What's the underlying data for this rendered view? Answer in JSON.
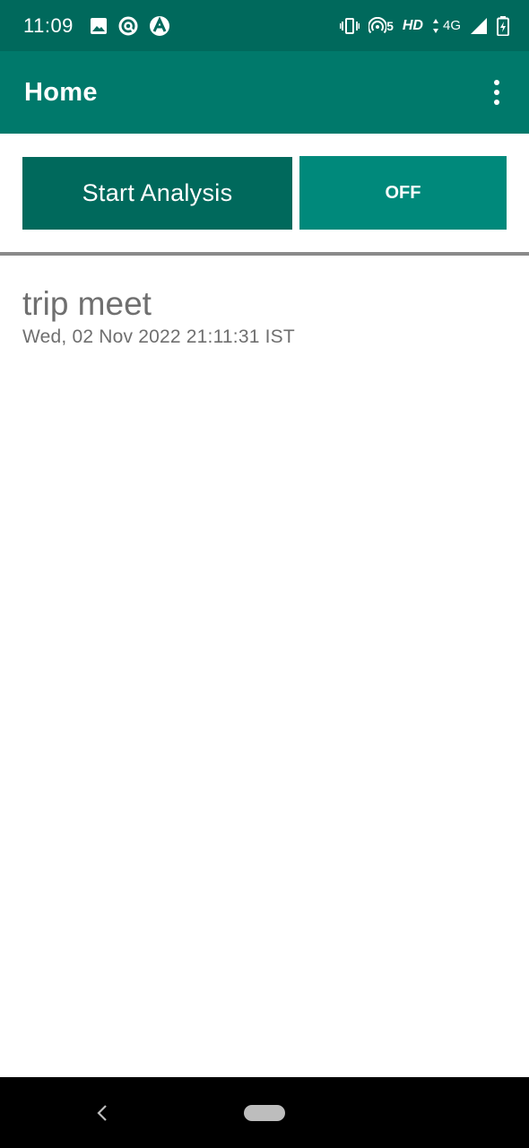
{
  "status_bar": {
    "time": "11:09",
    "left_icons": [
      "image-icon",
      "data-saver-icon",
      "vpn-a-icon"
    ],
    "right_icons": [
      "vibrate-icon",
      "hotspot-icon",
      "data-arrows-icon",
      "signal-icon",
      "battery-charging-icon"
    ],
    "cast_count": "5",
    "hd_label": "HD",
    "network_label": "4G"
  },
  "app_bar": {
    "title": "Home",
    "menu_icon": "more-vert-icon"
  },
  "actions": {
    "start_label": "Start Analysis",
    "toggle_label": "OFF"
  },
  "list": {
    "items": [
      {
        "title": "trip meet",
        "date": "Wed, 02 Nov 2022 21:11:31 IST"
      }
    ]
  },
  "nav_bar": {
    "back_icon": "back-chevron-icon",
    "home_icon": "home-pill-icon"
  },
  "colors": {
    "status_bar": "#00695c",
    "app_bar": "#00796b",
    "start_button": "#00695c",
    "toggle_button": "#00897b",
    "divider": "#8a8a8a",
    "text_secondary": "#6f6f6f"
  }
}
